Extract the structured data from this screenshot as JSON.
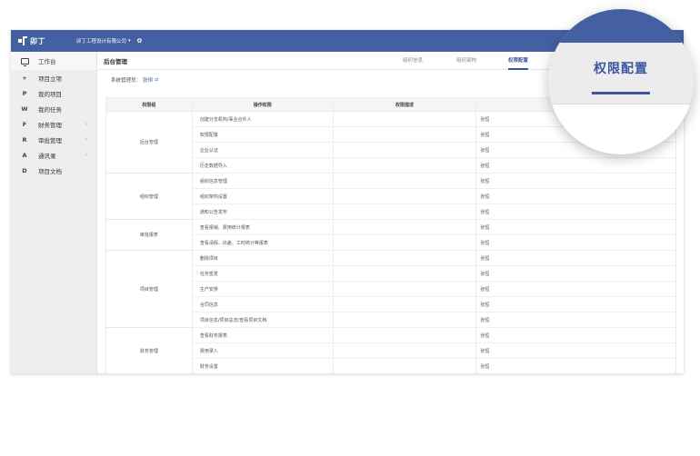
{
  "app": {
    "logo_text": "卯丁",
    "company": "卯丁工程设计有限公司",
    "company_caret": "▾",
    "gear_icon": "gear-icon"
  },
  "sidebar": {
    "items": [
      {
        "icon": "monitor-icon",
        "letter": "",
        "label": "工作台",
        "chevron": ""
      },
      {
        "icon": "plus-icon",
        "letter": "+",
        "label": "项目立项",
        "chevron": ""
      },
      {
        "icon": "letter-p-icon",
        "letter": "P",
        "label": "我的项目",
        "chevron": ""
      },
      {
        "icon": "letter-w-icon",
        "letter": "W",
        "label": "我的任务",
        "chevron": ""
      },
      {
        "icon": "letter-f-icon",
        "letter": "F",
        "label": "财务管理",
        "chevron": "‹"
      },
      {
        "icon": "letter-r-icon",
        "letter": "R",
        "label": "审批管理",
        "chevron": "‹"
      },
      {
        "icon": "letter-a-icon",
        "letter": "A",
        "label": "通讯录",
        "chevron": "‹"
      },
      {
        "icon": "letter-d-icon",
        "letter": "D",
        "label": "项目文档",
        "chevron": ""
      }
    ]
  },
  "main": {
    "title": "后台管理",
    "tabs": [
      {
        "label": "组织信息",
        "active": false
      },
      {
        "label": "组织架构",
        "active": false
      },
      {
        "label": "权限配置",
        "active": true
      }
    ],
    "admin_label": "系统管理员：",
    "admin_name": "张恒",
    "admin_icon": "swap-icon"
  },
  "table": {
    "headers": [
      "权限组",
      "操作权限",
      "权限描述",
      ""
    ],
    "groups": [
      {
        "name": "后台管理",
        "rows": [
          {
            "op": "创建分支机构/事业合伙人",
            "desc": "",
            "person": "张恒"
          },
          {
            "op": "权限配置",
            "desc": "",
            "person": "张恒"
          },
          {
            "op": "企业认证",
            "desc": "",
            "person": "张恒"
          },
          {
            "op": "历史数据导入",
            "desc": "",
            "person": "张恒"
          }
        ]
      },
      {
        "name": "组织管理",
        "rows": [
          {
            "op": "组织信息管理",
            "desc": "",
            "person": "张恒"
          },
          {
            "op": "组织架构设置",
            "desc": "",
            "person": "张恒"
          },
          {
            "op": "通知公告发布",
            "desc": "",
            "person": "张恒"
          }
        ]
      },
      {
        "name": "审批报表",
        "rows": [
          {
            "op": "查看报销、费用统计报表",
            "desc": "",
            "person": "张恒"
          },
          {
            "op": "查看请假、出差、工时统计等报表",
            "desc": "",
            "person": "张恒"
          }
        ]
      },
      {
        "name": "项目管理",
        "rows": [
          {
            "op": "删除项目",
            "desc": "",
            "person": "张恒"
          },
          {
            "op": "任务签发",
            "desc": "",
            "person": "张恒"
          },
          {
            "op": "生产安排",
            "desc": "",
            "person": "张恒"
          },
          {
            "op": "合同信息",
            "desc": "",
            "person": "张恒"
          },
          {
            "op": "项目信息/项目总览/查看项目文档",
            "desc": "",
            "person": "张恒"
          }
        ]
      },
      {
        "name": "财务管理",
        "rows": [
          {
            "op": "查看财务报表",
            "desc": "",
            "person": "张恒"
          },
          {
            "op": "费用录入",
            "desc": "",
            "person": "张恒"
          },
          {
            "op": "财务设置",
            "desc": "",
            "person": "张恒"
          }
        ]
      }
    ]
  },
  "magnifier": {
    "label": "权限配置"
  },
  "colors": {
    "brand": "#4460a2",
    "accent": "#3b56a0",
    "sidebar_bg": "#eeeeee"
  }
}
